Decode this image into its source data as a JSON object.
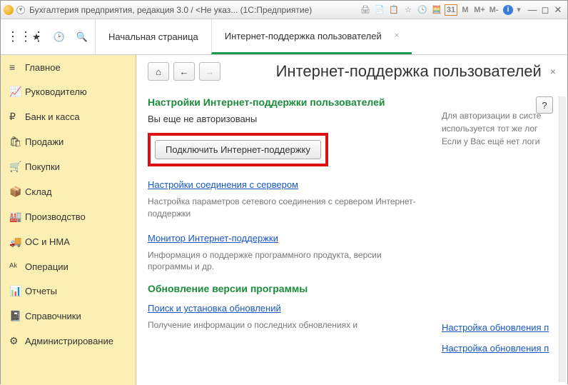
{
  "window": {
    "title": "Бухгалтерия предприятия, редакция 3.0 / <Не указ...   (1С:Предприятие)"
  },
  "tabs": {
    "home": "Начальная страница",
    "active": "Интернет-поддержка пользователей"
  },
  "sidebar": {
    "items": [
      {
        "icon": "≡",
        "label": "Главное"
      },
      {
        "icon": "📈",
        "label": "Руководителю"
      },
      {
        "icon": "₽",
        "label": "Банк и касса"
      },
      {
        "icon": "🛍",
        "label": "Продажи"
      },
      {
        "icon": "🛒",
        "label": "Покупки"
      },
      {
        "icon": "📦",
        "label": "Склад"
      },
      {
        "icon": "🏭",
        "label": "Производство"
      },
      {
        "icon": "🚚",
        "label": "ОС и НМА"
      },
      {
        "icon": "ᴬᵏ",
        "label": "Операции"
      },
      {
        "icon": "📊",
        "label": "Отчеты"
      },
      {
        "icon": "📓",
        "label": "Справочники"
      },
      {
        "icon": "⚙",
        "label": "Администрирование"
      }
    ]
  },
  "page": {
    "title": "Интернет-поддержка пользователей",
    "help": "?",
    "section1_title": "Настройки Интернет-поддержки пользователей",
    "not_authorized": "Вы еще не авторизованы",
    "connect_btn": "Подключить Интернет-поддержку",
    "auth_hint": "Для авторизации в систе используется тот же лог Если у Вас ещё нет логи",
    "conn_link": "Настройки соединения с сервером",
    "conn_desc": "Настройка параметров сетевого соединения с сервером Интернет-поддержки",
    "monitor_link": "Монитор Интернет-поддержки",
    "monitor_desc": "Информация о поддержке программного продукта, версии программы и др.",
    "section2_title": "Обновление версии программы",
    "update_link": "Поиск и установка обновлений",
    "update_desc": "Получение информации о последних обновлениях и",
    "right_link1": "Настройка обновления п",
    "right_link2": "Настройка обновления п"
  }
}
